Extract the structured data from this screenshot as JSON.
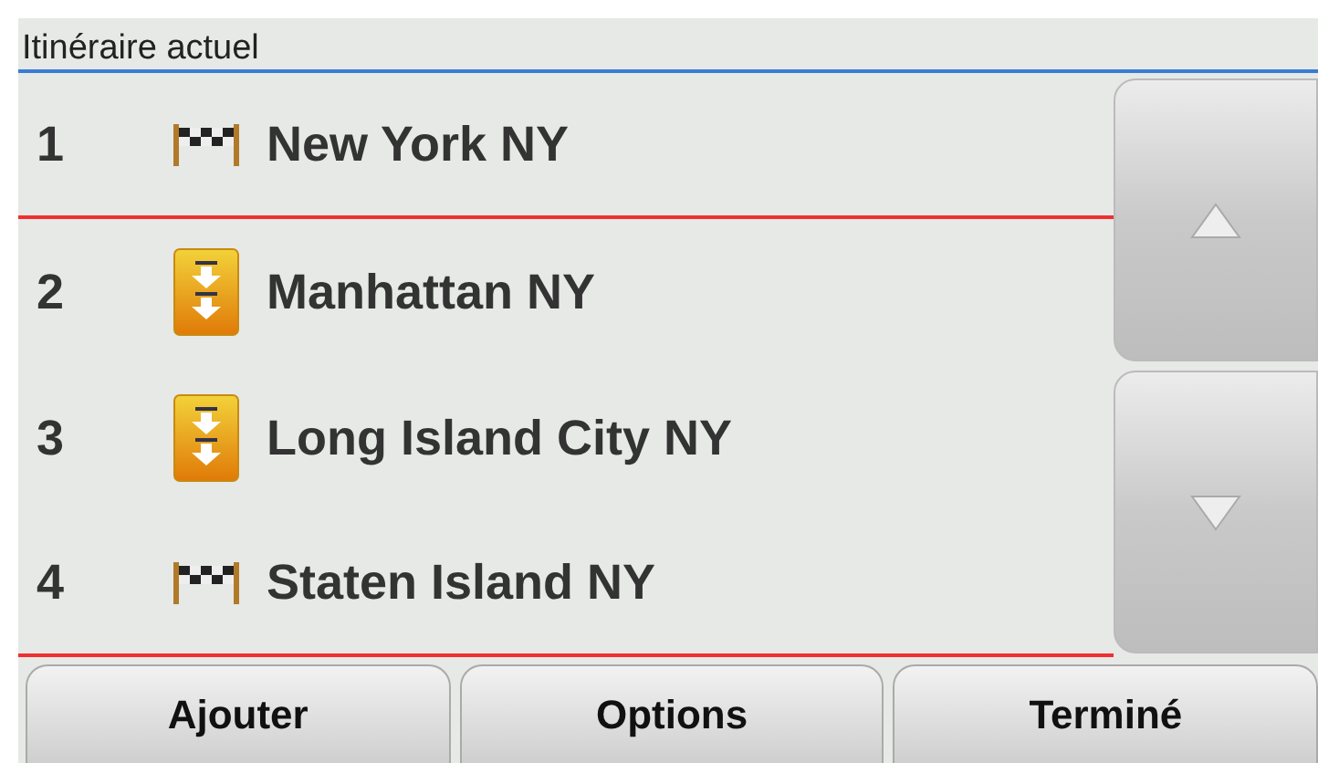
{
  "header": {
    "title": "Itinéraire actuel"
  },
  "stops": [
    {
      "number": "1",
      "name": "New York NY",
      "kind": "flag"
    },
    {
      "number": "2",
      "name": "Manhattan NY",
      "kind": "waypoint"
    },
    {
      "number": "3",
      "name": "Long Island City NY",
      "kind": "waypoint"
    },
    {
      "number": "4",
      "name": "Staten Island NY",
      "kind": "flag"
    }
  ],
  "buttons": [
    "Ajouter",
    "Options",
    "Terminé"
  ]
}
